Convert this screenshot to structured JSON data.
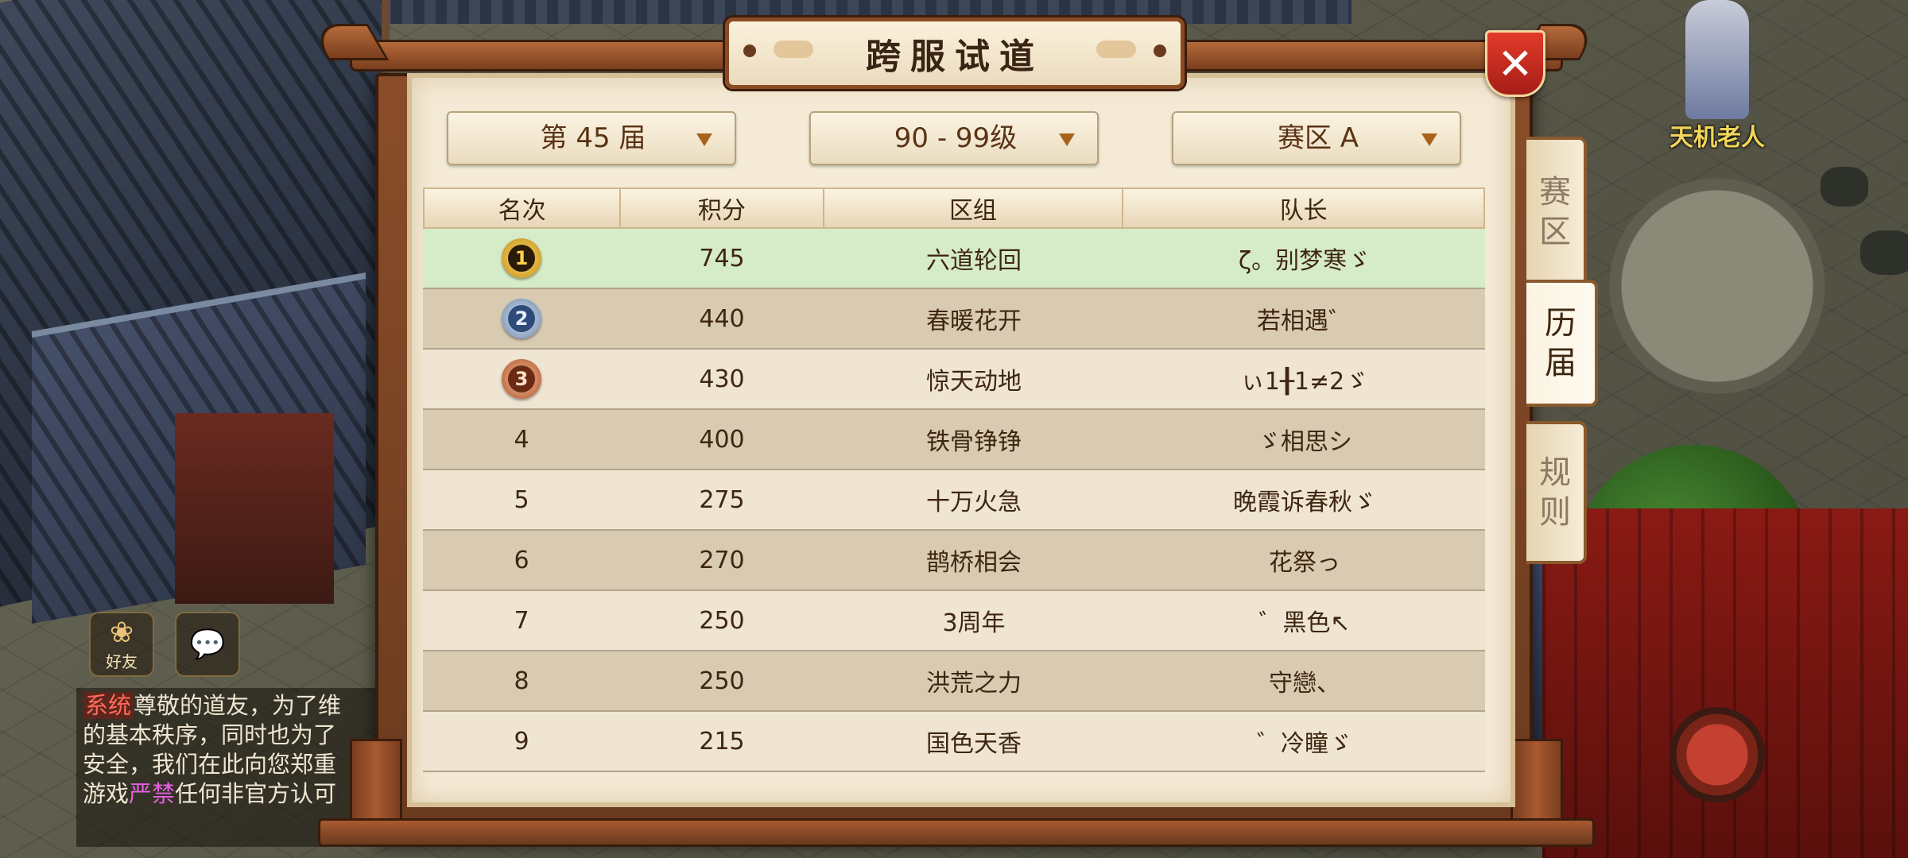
{
  "dialog": {
    "title": "跨服试道",
    "close_label": "✕"
  },
  "filters": {
    "season": "第 45 届",
    "level": "90 - 99级",
    "zone": "赛区 A"
  },
  "table": {
    "columns": [
      "名次",
      "积分",
      "区组",
      "队长"
    ],
    "rows": [
      {
        "rank": "1",
        "score": "745",
        "group": "六道轮回",
        "captain": "ζ。别梦寒ゞ"
      },
      {
        "rank": "2",
        "score": "440",
        "group": "春暖花开",
        "captain": "若相遇゛"
      },
      {
        "rank": "3",
        "score": "430",
        "group": "惊天动地",
        "captain": "ぃ1╂1≠2ゞ"
      },
      {
        "rank": "4",
        "score": "400",
        "group": "铁骨铮铮",
        "captain": "ゞ相思シ"
      },
      {
        "rank": "5",
        "score": "275",
        "group": "十万火急",
        "captain": "晚霞诉春秋ゞ"
      },
      {
        "rank": "6",
        "score": "270",
        "group": "鹊桥相会",
        "captain": "花祭っ"
      },
      {
        "rank": "7",
        "score": "250",
        "group": "3周年",
        "captain": "゛黑色↖"
      },
      {
        "rank": "8",
        "score": "250",
        "group": "洪荒之力",
        "captain": "守戀、"
      },
      {
        "rank": "9",
        "score": "215",
        "group": "国色天香",
        "captain": "゛冷瞳ゞ"
      }
    ]
  },
  "tabs": [
    {
      "label": [
        "赛",
        "区"
      ],
      "active": false
    },
    {
      "label": [
        "历",
        "届"
      ],
      "active": true
    },
    {
      "label": [
        "规",
        "则"
      ],
      "active": false
    }
  ],
  "npc": {
    "name": "天机老人"
  },
  "chat": {
    "friends_label": "好友",
    "messages_icon": "chat-bubble-icon",
    "system_tag": "系统",
    "line1": "尊敬的道友，为了维",
    "line2": "的基本秩序，同时也为了",
    "line3": "安全，我们在此向您郑重",
    "line4_a": "游戏",
    "line4_warn": "严禁",
    "line4_b": "任何非官方认可"
  }
}
